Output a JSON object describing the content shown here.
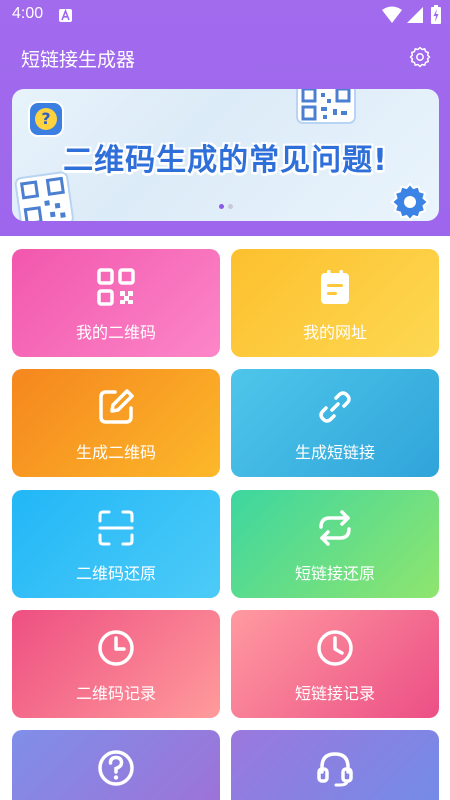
{
  "status_bar": {
    "time": "4:00"
  },
  "header": {
    "title": "短链接生成器"
  },
  "banner": {
    "headline": "二维码生成的常见问题!",
    "page_count": 2,
    "active_page": 0
  },
  "tiles": [
    {
      "label": "我的二维码",
      "icon": "qr-code-icon"
    },
    {
      "label": "我的网址",
      "icon": "clipboard-icon"
    },
    {
      "label": "生成二维码",
      "icon": "edit-icon"
    },
    {
      "label": "生成短链接",
      "icon": "link-icon"
    },
    {
      "label": "二维码还原",
      "icon": "scan-icon"
    },
    {
      "label": "短链接还原",
      "icon": "refresh-icon"
    },
    {
      "label": "二维码记录",
      "icon": "clock-icon"
    },
    {
      "label": "短链接记录",
      "icon": "clock-icon"
    },
    {
      "label": "",
      "icon": "help-icon"
    },
    {
      "label": "",
      "icon": "headset-icon"
    }
  ],
  "colors": {
    "header": "#9e68ec",
    "tile_pink": "#f76fb6",
    "tile_yellow": "#fdcb3c",
    "tile_orange": "#f8a822",
    "tile_blue": "#3fb6e2",
    "tile_cyan": "#2cc3f8",
    "tile_green": "#5bdd8e",
    "tile_rose": "#f0608b",
    "tile_peach": "#ff8fa2",
    "tile_violet": "#8a8fe8"
  }
}
